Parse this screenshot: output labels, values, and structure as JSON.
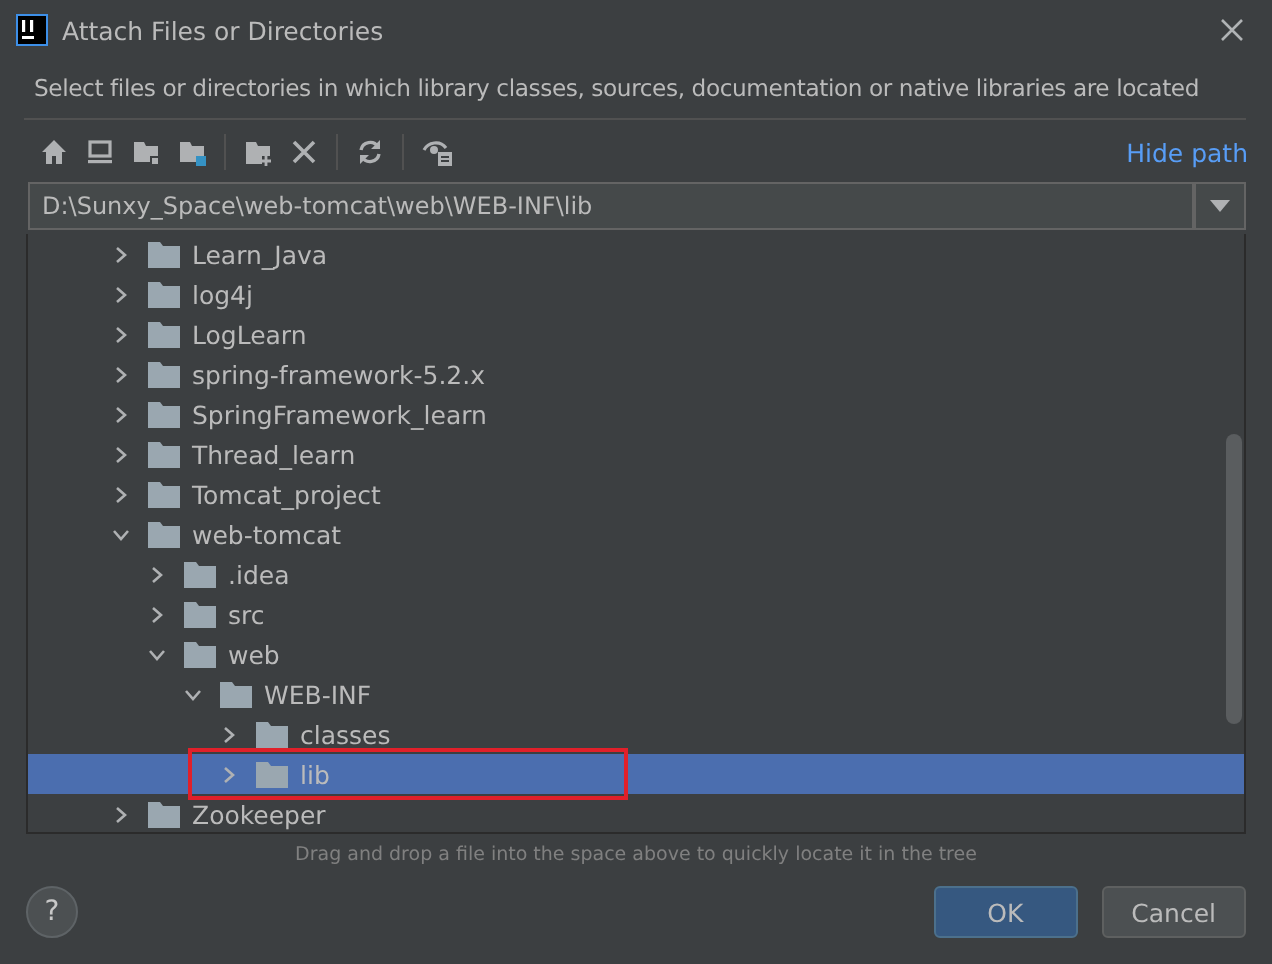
{
  "window": {
    "title": "Attach Files or Directories"
  },
  "description": "Select files or directories in which library classes, sources, documentation or native libraries are located",
  "toolbar": {
    "hide_path_link": "Hide path"
  },
  "path_field": {
    "value": "D:\\Sunxy_Space\\web-tomcat\\web\\WEB-INF\\lib"
  },
  "tree": [
    {
      "label": "Learn_Java",
      "expanded": false,
      "selected": false
    },
    {
      "label": "log4j",
      "expanded": false,
      "selected": false
    },
    {
      "label": "LogLearn",
      "expanded": false,
      "selected": false
    },
    {
      "label": "spring-framework-5.2.x",
      "expanded": false,
      "selected": false
    },
    {
      "label": "SpringFramework_learn",
      "expanded": false,
      "selected": false
    },
    {
      "label": "Thread_learn",
      "expanded": false,
      "selected": false
    },
    {
      "label": "Tomcat_project",
      "expanded": false,
      "selected": false
    },
    {
      "label": "web-tomcat",
      "expanded": true,
      "selected": false,
      "children": [
        {
          "label": ".idea",
          "expanded": false,
          "selected": false
        },
        {
          "label": "src",
          "expanded": false,
          "selected": false
        },
        {
          "label": "web",
          "expanded": true,
          "selected": false,
          "children": [
            {
              "label": "WEB-INF",
              "expanded": true,
              "selected": false,
              "children": [
                {
                  "label": "classes",
                  "expanded": false,
                  "selected": false
                },
                {
                  "label": "lib",
                  "expanded": false,
                  "selected": true
                }
              ]
            }
          ]
        }
      ]
    },
    {
      "label": "Zookeeper",
      "expanded": false,
      "selected": false
    }
  ],
  "hint": "Drag and drop a file into the space above to quickly locate it in the tree",
  "help_button": "?",
  "buttons": [
    {
      "label": "OK",
      "kind": "primary"
    },
    {
      "label": "Cancel",
      "kind": "secondary"
    }
  ]
}
